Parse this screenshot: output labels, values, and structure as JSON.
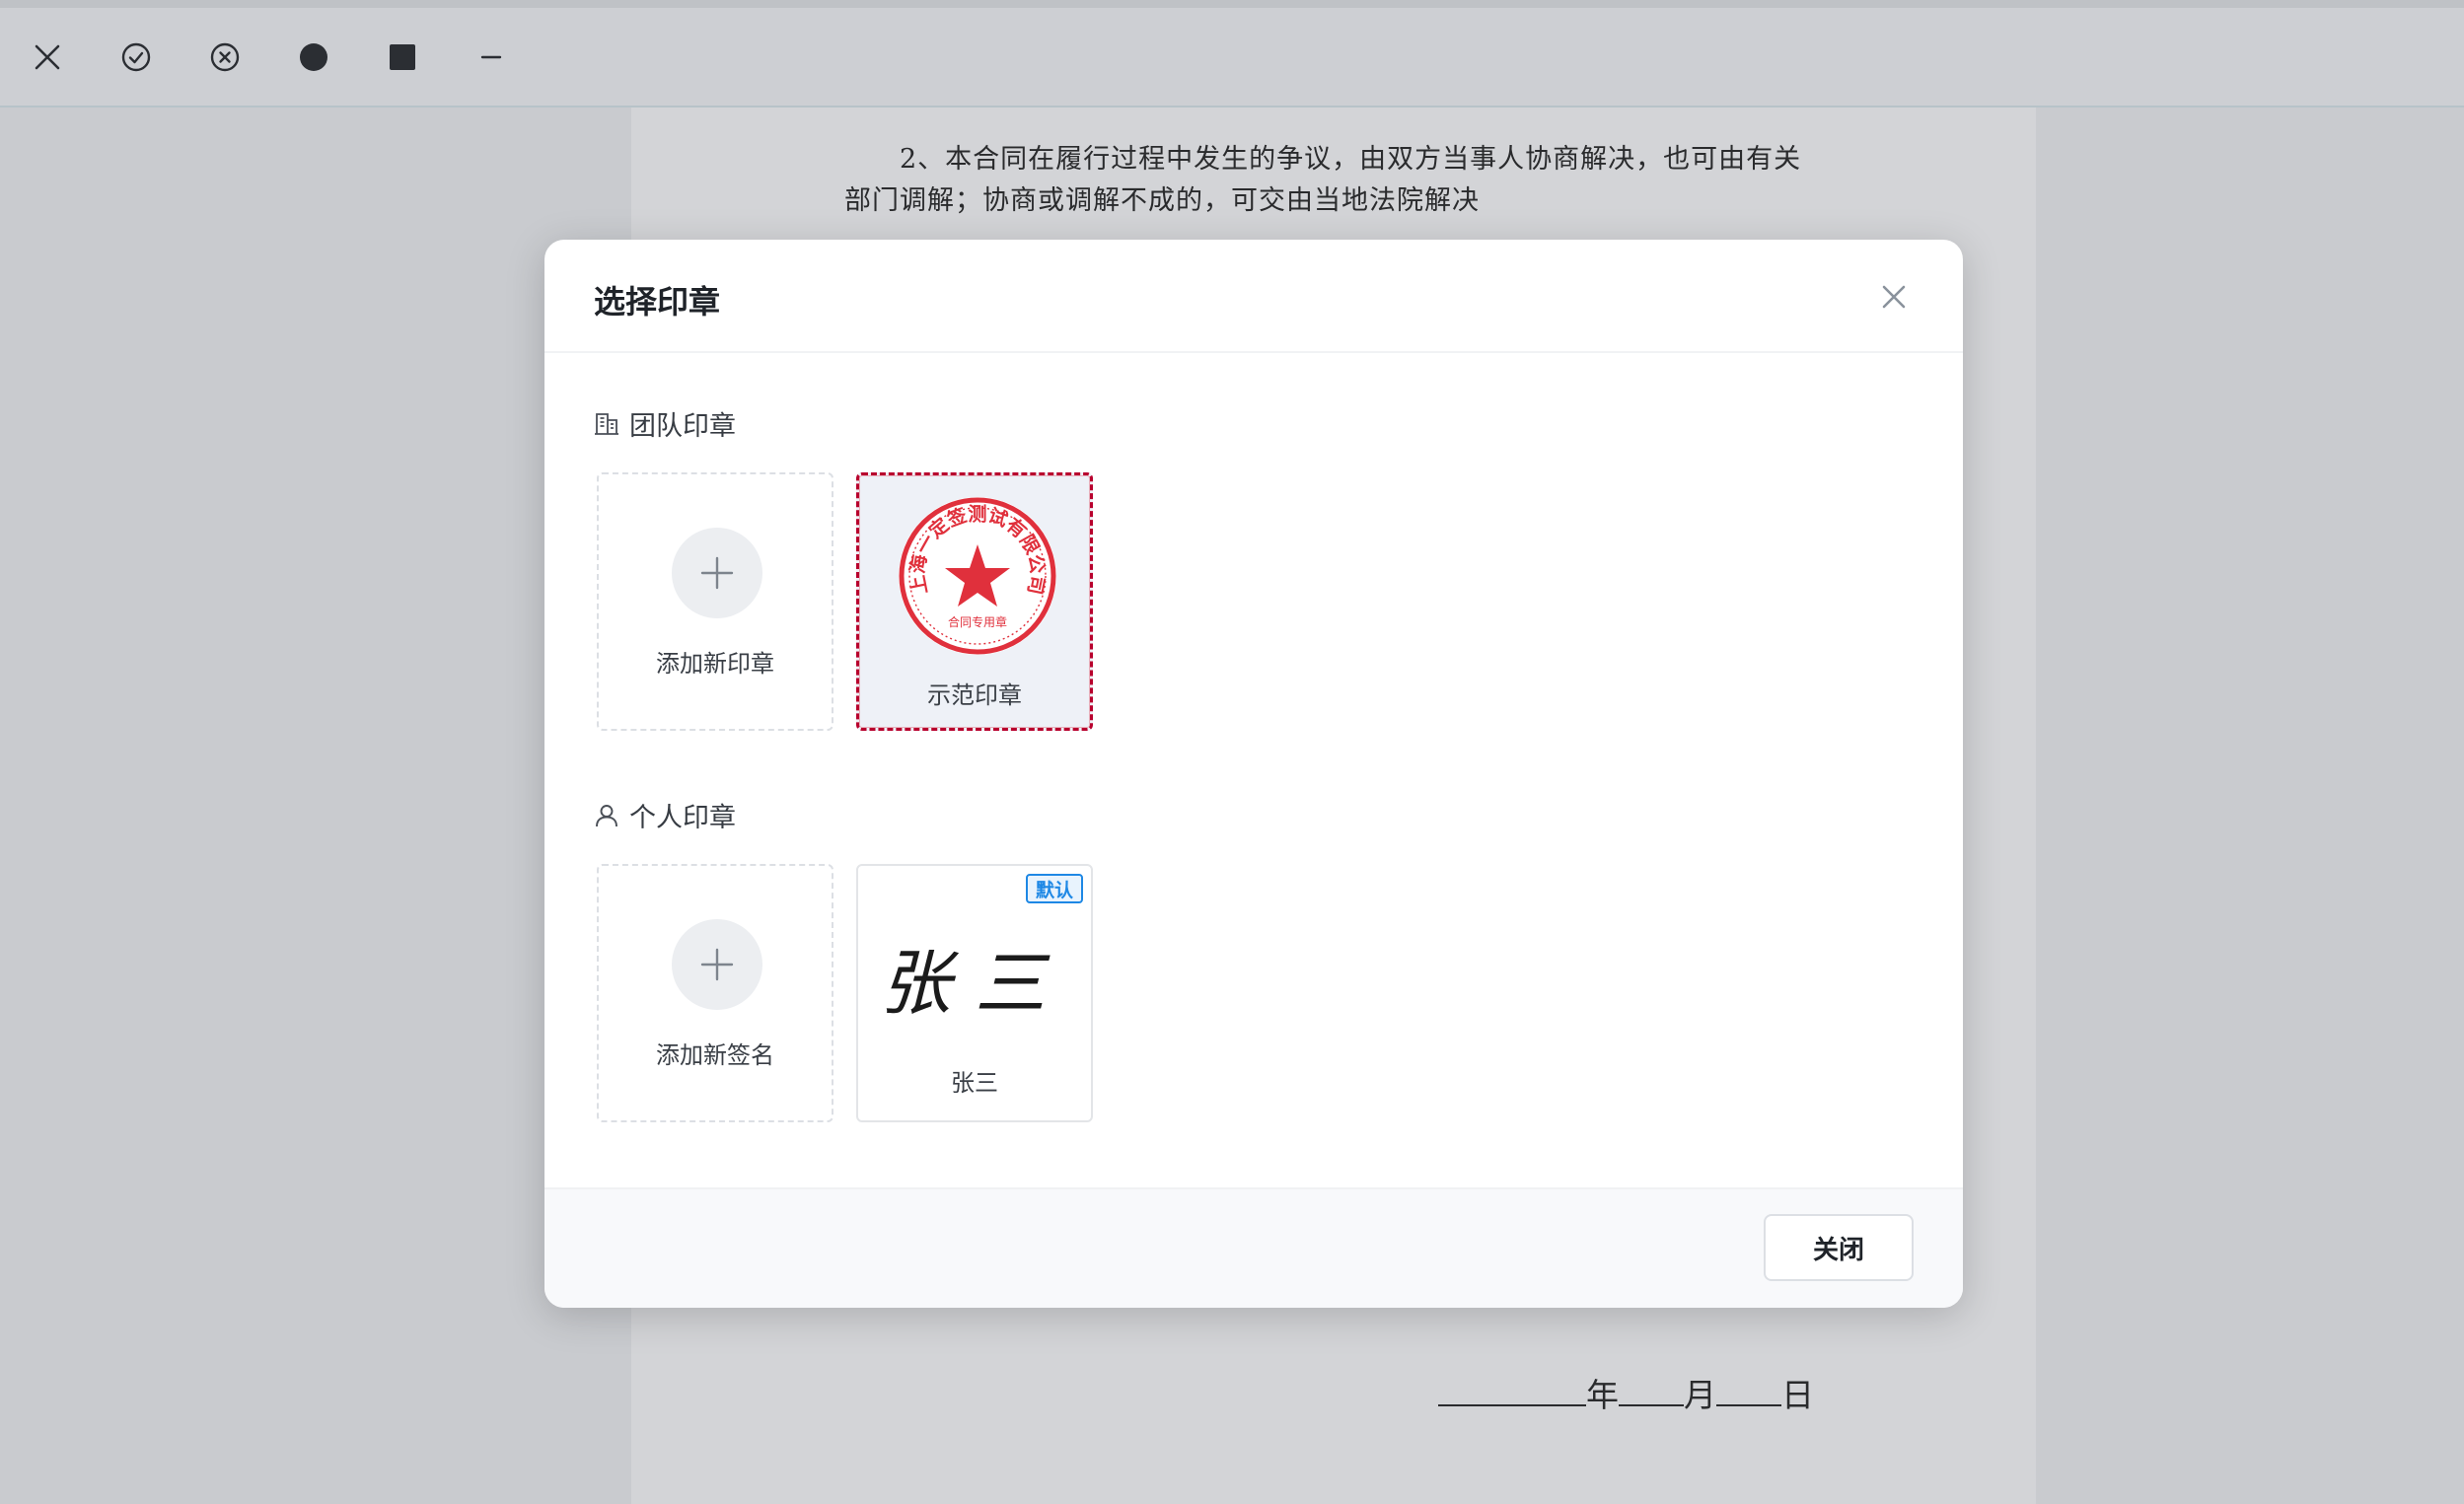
{
  "toolbar": {
    "tools": [
      {
        "icon": "close-icon"
      },
      {
        "icon": "check-circle-icon"
      },
      {
        "icon": "x-circle-icon"
      },
      {
        "icon": "filled-circle-icon"
      },
      {
        "icon": "filled-square-icon"
      },
      {
        "icon": "minus-icon"
      }
    ]
  },
  "document": {
    "line1": "2、本合同在履行过程中发生的争议，由双方当事人协商解决，也可由有关",
    "line2": "部门调解；协商或调解不成的，可交由当地法院解决",
    "date_year": "年",
    "date_month": "月",
    "date_day": "日"
  },
  "modal": {
    "title": "选择印章",
    "team_section": {
      "label": "团队印章",
      "add_label": "添加新印章",
      "seal": {
        "label": "示范印章",
        "seal_text": "上海一定签测试有限公司",
        "seal_sub": "合同专用章",
        "color": "#e0303c"
      }
    },
    "personal_section": {
      "label": "个人印章",
      "add_label": "添加新签名",
      "signature": {
        "label": "张三",
        "signature_text": "张三",
        "badge": "默认"
      }
    },
    "footer": {
      "close_label": "关闭"
    }
  }
}
